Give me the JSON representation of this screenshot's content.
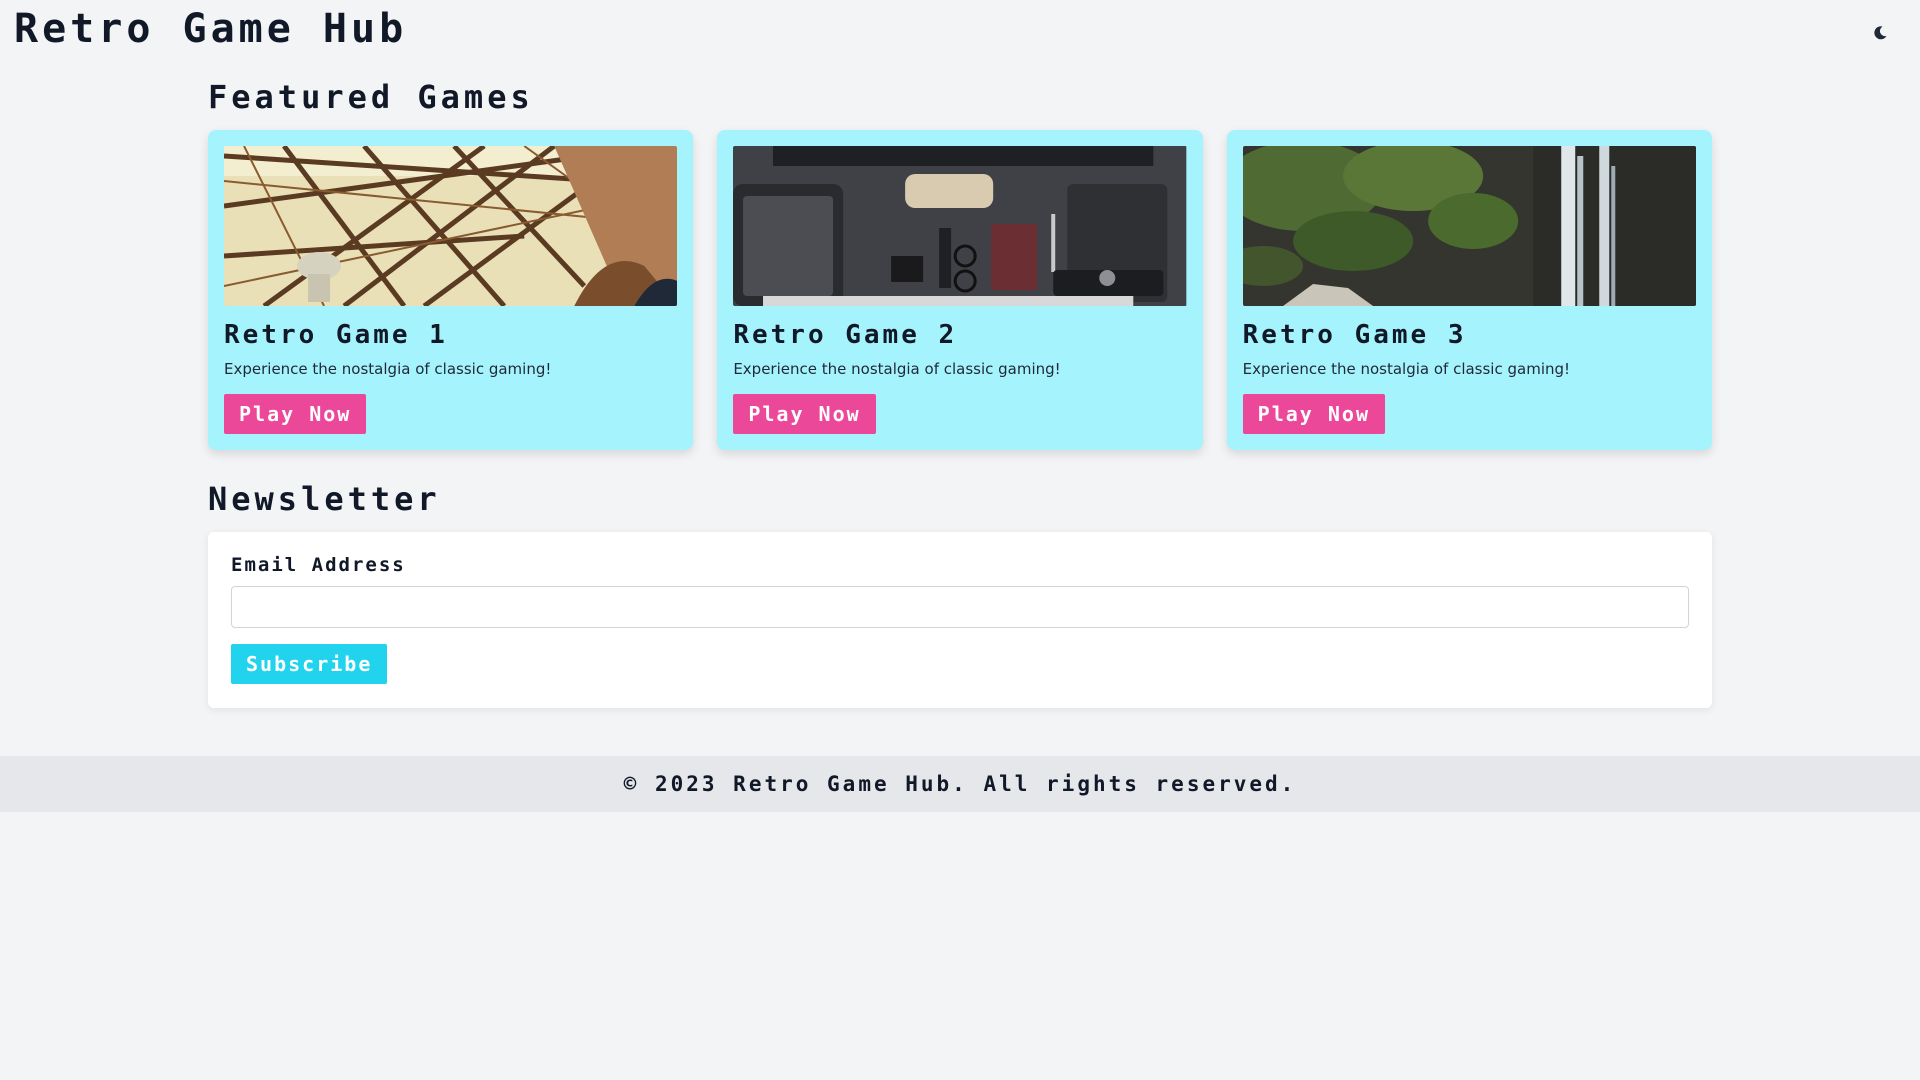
{
  "header": {
    "title": "Retro Game Hub",
    "theme_toggle_icon": "moon-icon"
  },
  "featured": {
    "title": "Featured Games",
    "games": [
      {
        "title": "Retro Game 1",
        "description": "Experience the nostalgia of classic gaming!",
        "button_label": "Play Now",
        "image": "eiffel-tower-structure-photo"
      },
      {
        "title": "Retro Game 2",
        "description": "Experience the nostalgia of classic gaming!",
        "button_label": "Play Now",
        "image": "desk-flatlay-photo"
      },
      {
        "title": "Retro Game 3",
        "description": "Experience the nostalgia of classic gaming!",
        "button_label": "Play Now",
        "image": "waterfall-photo"
      }
    ]
  },
  "newsletter": {
    "title": "Newsletter",
    "email_label": "Email Address",
    "email_value": "",
    "email_placeholder": "",
    "subscribe_label": "Subscribe"
  },
  "footer": {
    "text": "© 2023 Retro Game Hub. All rights reserved."
  },
  "colors": {
    "background": "#f3f4f6",
    "card": "#a5f3fc",
    "play_button": "#ec4899",
    "subscribe_button": "#22d3ee",
    "footer": "#e5e7eb"
  }
}
